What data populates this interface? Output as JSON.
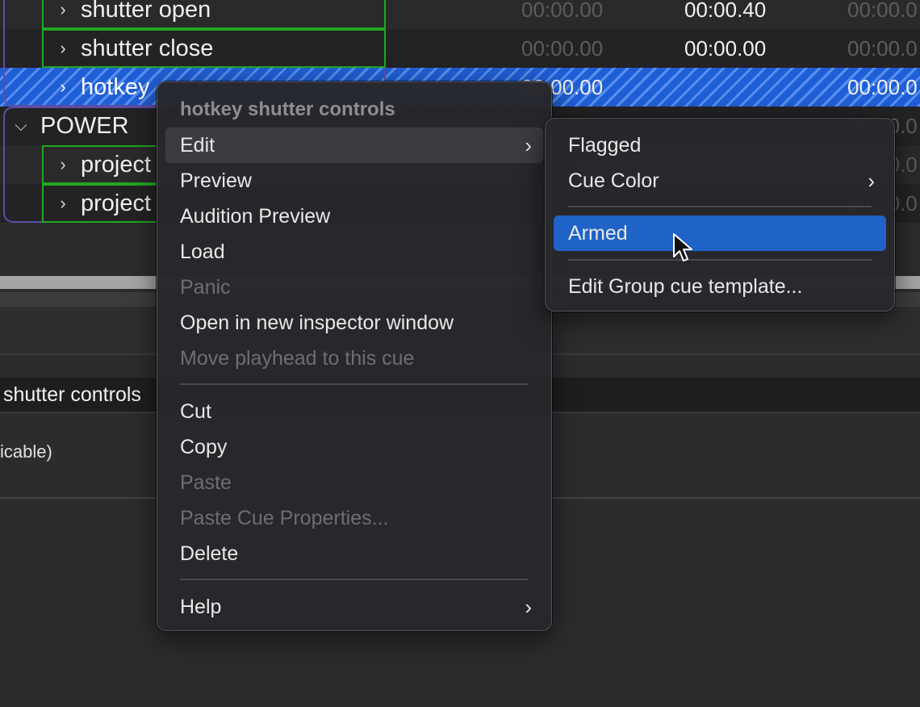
{
  "cue_list": {
    "rows": [
      {
        "name": "shutter open",
        "col1": "00:00.00",
        "col2": "00:00.40",
        "col3": "00:00.0"
      },
      {
        "name": "shutter close",
        "col1": "00:00.00",
        "col2": "00:00.00",
        "col3": "00:00.0"
      },
      {
        "name": "hotkey",
        "col1": "00:00.00",
        "col3": "00:00.0"
      },
      {
        "name": "POWER",
        "col3": "00:00.0"
      },
      {
        "name": "project",
        "col3": "00:00.0"
      },
      {
        "name": "project",
        "col3": "00:00.0"
      }
    ]
  },
  "inspector": {
    "title": "shutter controls",
    "text": "icable)"
  },
  "context_menu": {
    "header": "hotkey shutter controls",
    "items": [
      {
        "label": "Edit",
        "has_submenu": true
      },
      {
        "label": "Preview"
      },
      {
        "label": "Audition Preview"
      },
      {
        "label": "Load"
      },
      {
        "label": "Panic",
        "disabled": true
      },
      {
        "label": "Open in new inspector window"
      },
      {
        "label": "Move playhead to this cue",
        "disabled": true
      },
      {
        "label": "Cut"
      },
      {
        "label": "Copy"
      },
      {
        "label": "Paste",
        "disabled": true
      },
      {
        "label": "Paste Cue Properties...",
        "disabled": true
      },
      {
        "label": "Delete"
      },
      {
        "label": "Help",
        "has_submenu": true
      }
    ]
  },
  "submenu": {
    "items": [
      {
        "label": "Flagged"
      },
      {
        "label": "Cue Color",
        "has_submenu": true
      },
      {
        "label": "Armed",
        "highlighted": true
      },
      {
        "label": "Edit Group cue template..."
      }
    ]
  },
  "colors": {
    "selection_blue": "#1f5fd6",
    "menu_highlight": "#1f63c6",
    "group_green": "#21a81e",
    "group_purple": "#5c4ea8"
  },
  "icons": {
    "disclosure": "chevron-right-icon",
    "expanded": "chevron-down-icon",
    "submenu": "chevron-right-icon",
    "pointer": "arrow-cursor-icon"
  }
}
